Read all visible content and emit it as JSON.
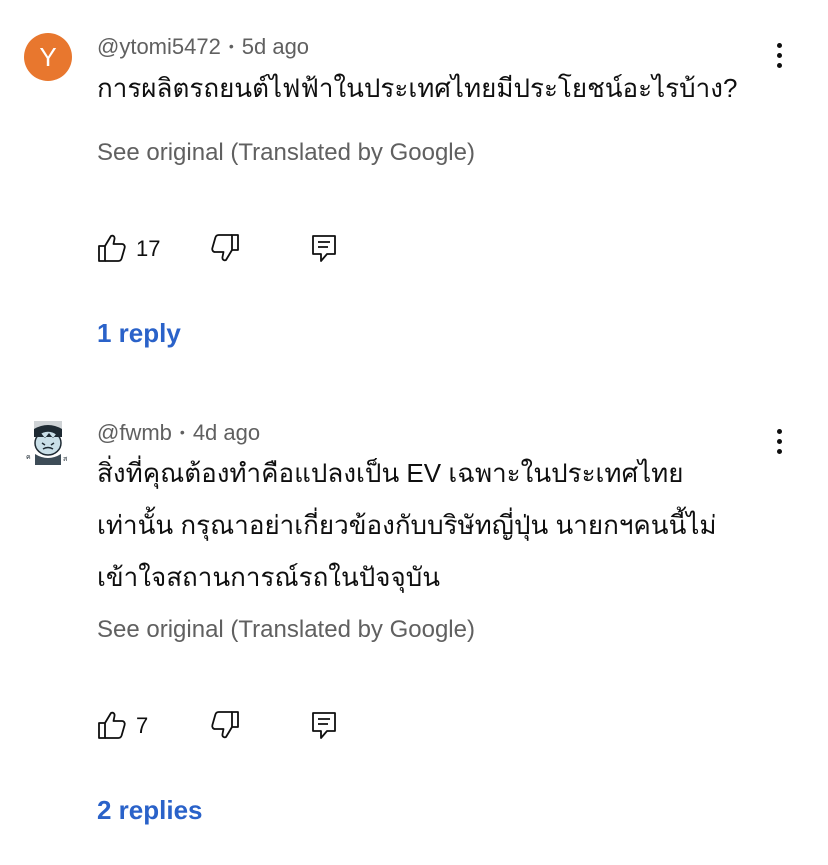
{
  "comments": [
    {
      "avatar_letter": "Y",
      "avatar_color": "#e8772e",
      "author": "@ytomi5472",
      "time": "5d ago",
      "text_lines": [
        "การผลิตรถยนต์ไฟฟ้าในประเทศไทยมีประโยชน์อะไรบ้าง?"
      ],
      "see_original": "See original (Translated by Google)",
      "likes": "17",
      "replies_label": "1 reply"
    },
    {
      "avatar_icon": "cartoon-avatar-icon",
      "author": "@fwmb",
      "time": "4d ago",
      "text_lines": [
        "สิ่งที่คุณต้องทำคือแปลงเป็น EV เฉพาะในประเทศไทย",
        "เท่านั้น กรุณาอย่าเกี่ยวข้องกับบริษัทญี่ปุ่น นายกฯคนนี้ไม่",
        "เข้าใจสถานการณ์รถในปัจจุบัน"
      ],
      "see_original": "See original (Translated by Google)",
      "likes": "7",
      "replies_label": "2 replies"
    }
  ],
  "colors": {
    "link": "#2a62c9",
    "meta": "#606060",
    "text": "#0f0f0f"
  }
}
